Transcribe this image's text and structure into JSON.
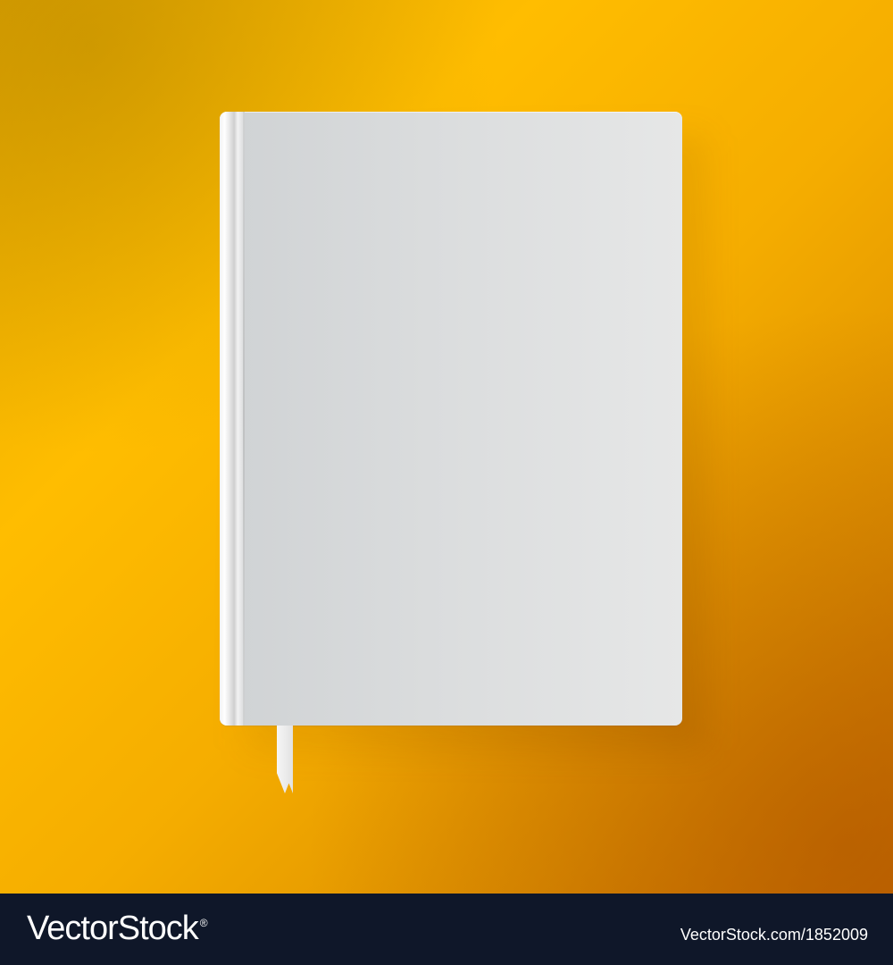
{
  "footer": {
    "brand": "VectorStock",
    "registered": "®",
    "url": "VectorStock.com/1852009"
  },
  "colors": {
    "background_top_left": "#e0a400",
    "background_mid": "#ffbd00",
    "background_bottom_right": "#c96f00",
    "book_cover": "#dcdedf",
    "footer_bg": "#0f1729"
  },
  "icons": {
    "book": "blank-book-icon",
    "bookmark": "ribbon-bookmark-icon"
  }
}
